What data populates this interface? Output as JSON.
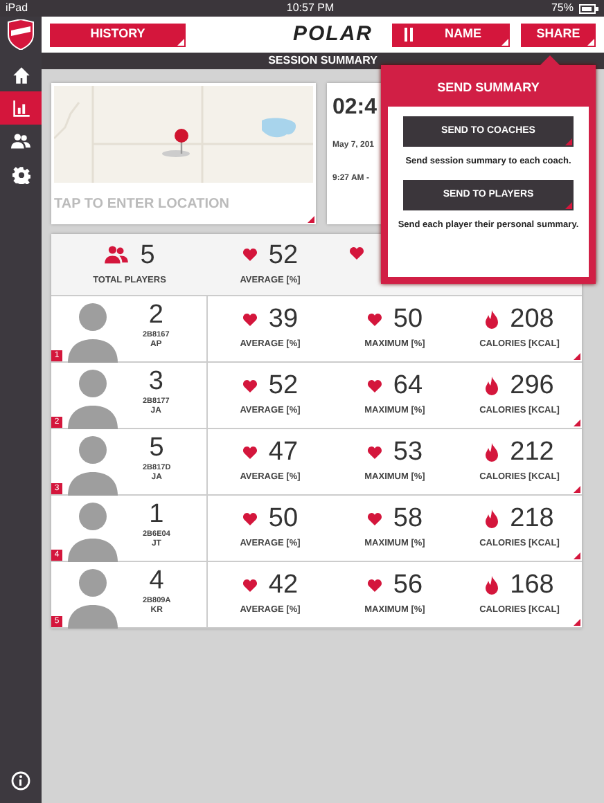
{
  "status_bar": {
    "device": "iPad",
    "time": "10:57 PM",
    "battery": "75%"
  },
  "sidebar": {
    "items": [
      {
        "kind": "home",
        "selected": false
      },
      {
        "kind": "chart",
        "selected": true
      },
      {
        "kind": "people",
        "selected": false
      },
      {
        "kind": "gear",
        "selected": false
      }
    ]
  },
  "toolbar": {
    "history": "HISTORY",
    "logo": "POLAR",
    "sort": "NAME",
    "share": "SHARE"
  },
  "title": "SESSION SUMMARY",
  "location": {
    "placeholder": "TAP TO ENTER LOCATION"
  },
  "time_card": {
    "duration": "02:4",
    "date": "May 7, 201",
    "time": "9:27 AM -"
  },
  "totals": {
    "players": "5",
    "players_label": "TOTAL PLAYERS",
    "average": "52",
    "average_label": "AVERAGE [%]"
  },
  "players": [
    {
      "rank": "1",
      "number": "2",
      "id": "2B8167",
      "initials": "AP",
      "stats": [
        {
          "kind": "heart",
          "value": "39",
          "label": "AVERAGE [%]"
        },
        {
          "kind": "heart",
          "value": "50",
          "label": "MAXIMUM [%]"
        },
        {
          "kind": "flame",
          "value": "208",
          "label": "CALORIES [KCAL]"
        }
      ]
    },
    {
      "rank": "2",
      "number": "3",
      "id": "2B8177",
      "initials": "JA",
      "stats": [
        {
          "kind": "heart",
          "value": "52",
          "label": "AVERAGE [%]"
        },
        {
          "kind": "heart",
          "value": "64",
          "label": "MAXIMUM [%]"
        },
        {
          "kind": "flame",
          "value": "296",
          "label": "CALORIES [KCAL]"
        }
      ]
    },
    {
      "rank": "3",
      "number": "5",
      "id": "2B817D",
      "initials": "JA",
      "stats": [
        {
          "kind": "heart",
          "value": "47",
          "label": "AVERAGE [%]"
        },
        {
          "kind": "heart",
          "value": "53",
          "label": "MAXIMUM [%]"
        },
        {
          "kind": "flame",
          "value": "212",
          "label": "CALORIES [KCAL]"
        }
      ]
    },
    {
      "rank": "4",
      "number": "1",
      "id": "2B6E04",
      "initials": "JT",
      "stats": [
        {
          "kind": "heart",
          "value": "50",
          "label": "AVERAGE [%]"
        },
        {
          "kind": "heart",
          "value": "58",
          "label": "MAXIMUM [%]"
        },
        {
          "kind": "flame",
          "value": "218",
          "label": "CALORIES [KCAL]"
        }
      ]
    },
    {
      "rank": "5",
      "number": "4",
      "id": "2B809A",
      "initials": "KR",
      "stats": [
        {
          "kind": "heart",
          "value": "42",
          "label": "AVERAGE [%]"
        },
        {
          "kind": "heart",
          "value": "56",
          "label": "MAXIMUM [%]"
        },
        {
          "kind": "flame",
          "value": "168",
          "label": "CALORIES [KCAL]"
        }
      ]
    }
  ],
  "popup": {
    "title": "SEND SUMMARY",
    "actions": [
      {
        "button": "SEND TO COACHES",
        "description": "Send session summary to each coach."
      },
      {
        "button": "SEND TO PLAYERS",
        "description": "Send each player their personal summary."
      }
    ]
  }
}
